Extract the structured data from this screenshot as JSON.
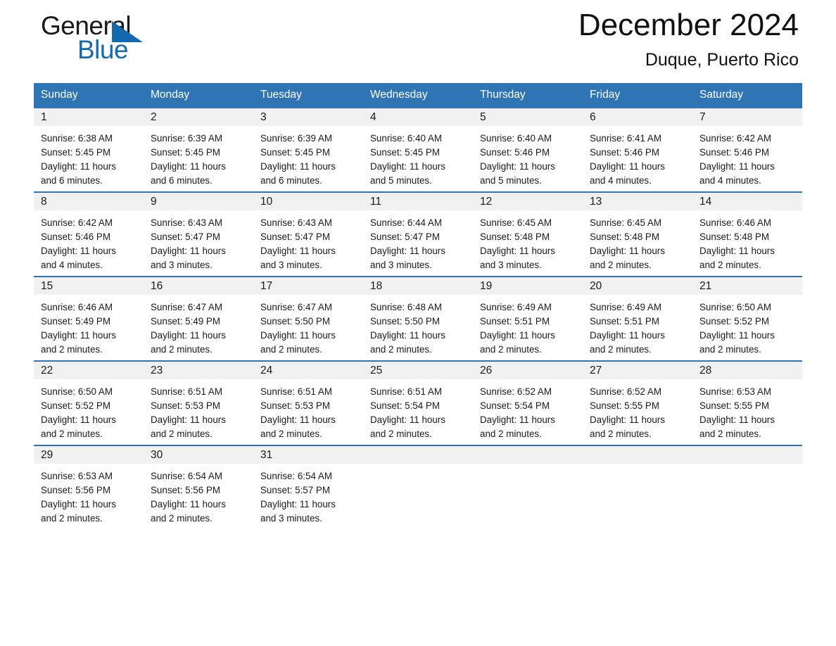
{
  "brand": {
    "name_part1": "General",
    "name_part2": "Blue",
    "logo_color": "#1569b0"
  },
  "header": {
    "month_title": "December 2024",
    "location": "Duque, Puerto Rico"
  },
  "theme": {
    "header_blue": "#2f75b5",
    "daynum_band": "#f1f1f1",
    "text": "#1a1a1a"
  },
  "calendar": {
    "weekday_headers": [
      "Sunday",
      "Monday",
      "Tuesday",
      "Wednesday",
      "Thursday",
      "Friday",
      "Saturday"
    ],
    "labels": {
      "sunrise": "Sunrise:",
      "sunset": "Sunset:",
      "daylight": "Daylight:"
    },
    "weeks": [
      [
        {
          "day": "1",
          "sunrise": "Sunrise: 6:38 AM",
          "sunset": "Sunset: 5:45 PM",
          "daylight_line1": "Daylight: 11 hours",
          "daylight_line2": "and 6 minutes."
        },
        {
          "day": "2",
          "sunrise": "Sunrise: 6:39 AM",
          "sunset": "Sunset: 5:45 PM",
          "daylight_line1": "Daylight: 11 hours",
          "daylight_line2": "and 6 minutes."
        },
        {
          "day": "3",
          "sunrise": "Sunrise: 6:39 AM",
          "sunset": "Sunset: 5:45 PM",
          "daylight_line1": "Daylight: 11 hours",
          "daylight_line2": "and 6 minutes."
        },
        {
          "day": "4",
          "sunrise": "Sunrise: 6:40 AM",
          "sunset": "Sunset: 5:45 PM",
          "daylight_line1": "Daylight: 11 hours",
          "daylight_line2": "and 5 minutes."
        },
        {
          "day": "5",
          "sunrise": "Sunrise: 6:40 AM",
          "sunset": "Sunset: 5:46 PM",
          "daylight_line1": "Daylight: 11 hours",
          "daylight_line2": "and 5 minutes."
        },
        {
          "day": "6",
          "sunrise": "Sunrise: 6:41 AM",
          "sunset": "Sunset: 5:46 PM",
          "daylight_line1": "Daylight: 11 hours",
          "daylight_line2": "and 4 minutes."
        },
        {
          "day": "7",
          "sunrise": "Sunrise: 6:42 AM",
          "sunset": "Sunset: 5:46 PM",
          "daylight_line1": "Daylight: 11 hours",
          "daylight_line2": "and 4 minutes."
        }
      ],
      [
        {
          "day": "8",
          "sunrise": "Sunrise: 6:42 AM",
          "sunset": "Sunset: 5:46 PM",
          "daylight_line1": "Daylight: 11 hours",
          "daylight_line2": "and 4 minutes."
        },
        {
          "day": "9",
          "sunrise": "Sunrise: 6:43 AM",
          "sunset": "Sunset: 5:47 PM",
          "daylight_line1": "Daylight: 11 hours",
          "daylight_line2": "and 3 minutes."
        },
        {
          "day": "10",
          "sunrise": "Sunrise: 6:43 AM",
          "sunset": "Sunset: 5:47 PM",
          "daylight_line1": "Daylight: 11 hours",
          "daylight_line2": "and 3 minutes."
        },
        {
          "day": "11",
          "sunrise": "Sunrise: 6:44 AM",
          "sunset": "Sunset: 5:47 PM",
          "daylight_line1": "Daylight: 11 hours",
          "daylight_line2": "and 3 minutes."
        },
        {
          "day": "12",
          "sunrise": "Sunrise: 6:45 AM",
          "sunset": "Sunset: 5:48 PM",
          "daylight_line1": "Daylight: 11 hours",
          "daylight_line2": "and 3 minutes."
        },
        {
          "day": "13",
          "sunrise": "Sunrise: 6:45 AM",
          "sunset": "Sunset: 5:48 PM",
          "daylight_line1": "Daylight: 11 hours",
          "daylight_line2": "and 2 minutes."
        },
        {
          "day": "14",
          "sunrise": "Sunrise: 6:46 AM",
          "sunset": "Sunset: 5:48 PM",
          "daylight_line1": "Daylight: 11 hours",
          "daylight_line2": "and 2 minutes."
        }
      ],
      [
        {
          "day": "15",
          "sunrise": "Sunrise: 6:46 AM",
          "sunset": "Sunset: 5:49 PM",
          "daylight_line1": "Daylight: 11 hours",
          "daylight_line2": "and 2 minutes."
        },
        {
          "day": "16",
          "sunrise": "Sunrise: 6:47 AM",
          "sunset": "Sunset: 5:49 PM",
          "daylight_line1": "Daylight: 11 hours",
          "daylight_line2": "and 2 minutes."
        },
        {
          "day": "17",
          "sunrise": "Sunrise: 6:47 AM",
          "sunset": "Sunset: 5:50 PM",
          "daylight_line1": "Daylight: 11 hours",
          "daylight_line2": "and 2 minutes."
        },
        {
          "day": "18",
          "sunrise": "Sunrise: 6:48 AM",
          "sunset": "Sunset: 5:50 PM",
          "daylight_line1": "Daylight: 11 hours",
          "daylight_line2": "and 2 minutes."
        },
        {
          "day": "19",
          "sunrise": "Sunrise: 6:49 AM",
          "sunset": "Sunset: 5:51 PM",
          "daylight_line1": "Daylight: 11 hours",
          "daylight_line2": "and 2 minutes."
        },
        {
          "day": "20",
          "sunrise": "Sunrise: 6:49 AM",
          "sunset": "Sunset: 5:51 PM",
          "daylight_line1": "Daylight: 11 hours",
          "daylight_line2": "and 2 minutes."
        },
        {
          "day": "21",
          "sunrise": "Sunrise: 6:50 AM",
          "sunset": "Sunset: 5:52 PM",
          "daylight_line1": "Daylight: 11 hours",
          "daylight_line2": "and 2 minutes."
        }
      ],
      [
        {
          "day": "22",
          "sunrise": "Sunrise: 6:50 AM",
          "sunset": "Sunset: 5:52 PM",
          "daylight_line1": "Daylight: 11 hours",
          "daylight_line2": "and 2 minutes."
        },
        {
          "day": "23",
          "sunrise": "Sunrise: 6:51 AM",
          "sunset": "Sunset: 5:53 PM",
          "daylight_line1": "Daylight: 11 hours",
          "daylight_line2": "and 2 minutes."
        },
        {
          "day": "24",
          "sunrise": "Sunrise: 6:51 AM",
          "sunset": "Sunset: 5:53 PM",
          "daylight_line1": "Daylight: 11 hours",
          "daylight_line2": "and 2 minutes."
        },
        {
          "day": "25",
          "sunrise": "Sunrise: 6:51 AM",
          "sunset": "Sunset: 5:54 PM",
          "daylight_line1": "Daylight: 11 hours",
          "daylight_line2": "and 2 minutes."
        },
        {
          "day": "26",
          "sunrise": "Sunrise: 6:52 AM",
          "sunset": "Sunset: 5:54 PM",
          "daylight_line1": "Daylight: 11 hours",
          "daylight_line2": "and 2 minutes."
        },
        {
          "day": "27",
          "sunrise": "Sunrise: 6:52 AM",
          "sunset": "Sunset: 5:55 PM",
          "daylight_line1": "Daylight: 11 hours",
          "daylight_line2": "and 2 minutes."
        },
        {
          "day": "28",
          "sunrise": "Sunrise: 6:53 AM",
          "sunset": "Sunset: 5:55 PM",
          "daylight_line1": "Daylight: 11 hours",
          "daylight_line2": "and 2 minutes."
        }
      ],
      [
        {
          "day": "29",
          "sunrise": "Sunrise: 6:53 AM",
          "sunset": "Sunset: 5:56 PM",
          "daylight_line1": "Daylight: 11 hours",
          "daylight_line2": "and 2 minutes."
        },
        {
          "day": "30",
          "sunrise": "Sunrise: 6:54 AM",
          "sunset": "Sunset: 5:56 PM",
          "daylight_line1": "Daylight: 11 hours",
          "daylight_line2": "and 2 minutes."
        },
        {
          "day": "31",
          "sunrise": "Sunrise: 6:54 AM",
          "sunset": "Sunset: 5:57 PM",
          "daylight_line1": "Daylight: 11 hours",
          "daylight_line2": "and 3 minutes."
        },
        {
          "day": "",
          "sunrise": "",
          "sunset": "",
          "daylight_line1": "",
          "daylight_line2": ""
        },
        {
          "day": "",
          "sunrise": "",
          "sunset": "",
          "daylight_line1": "",
          "daylight_line2": ""
        },
        {
          "day": "",
          "sunrise": "",
          "sunset": "",
          "daylight_line1": "",
          "daylight_line2": ""
        },
        {
          "day": "",
          "sunrise": "",
          "sunset": "",
          "daylight_line1": "",
          "daylight_line2": ""
        }
      ]
    ]
  }
}
